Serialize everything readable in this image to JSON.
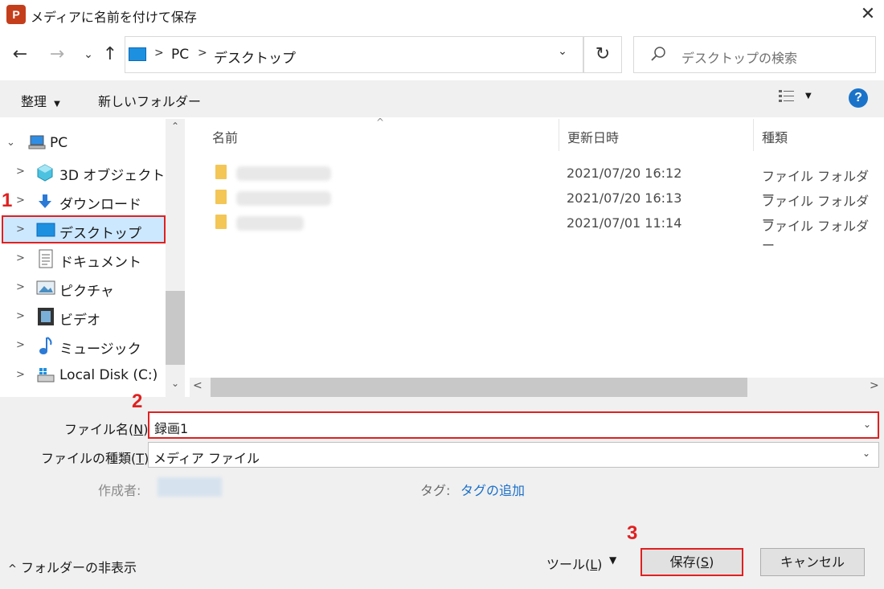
{
  "window": {
    "title": "メディアに名前を付けて保存",
    "app_icon_letter": "P"
  },
  "address": {
    "crumbs": [
      "PC",
      "デスクトップ"
    ]
  },
  "search": {
    "placeholder": "デスクトップの検索"
  },
  "toolbar": {
    "organize_label": "整理",
    "new_folder_label": "新しいフォルダー"
  },
  "nav_tree": {
    "root": "PC",
    "items": [
      {
        "label": "3D オブジェクト",
        "icon": "3d-objects-icon"
      },
      {
        "label": "ダウンロード",
        "icon": "download-icon"
      },
      {
        "label": "デスクトップ",
        "icon": "desktop-icon",
        "selected": true
      },
      {
        "label": "ドキュメント",
        "icon": "documents-icon"
      },
      {
        "label": "ピクチャ",
        "icon": "pictures-icon"
      },
      {
        "label": "ビデオ",
        "icon": "videos-icon"
      },
      {
        "label": "ミュージック",
        "icon": "music-icon"
      },
      {
        "label": "Local Disk (C:)",
        "icon": "local-disk-icon"
      }
    ]
  },
  "file_list": {
    "columns": [
      "名前",
      "更新日時",
      "種類"
    ],
    "rows": [
      {
        "date": "2021/07/20 16:12",
        "type": "ファイル フォルダー"
      },
      {
        "date": "2021/07/20 16:13",
        "type": "ファイル フォルダー"
      },
      {
        "date": "2021/07/01 11:14",
        "type": "ファイル フォルダー"
      }
    ]
  },
  "form": {
    "filename_label": "ファイル名(N):",
    "filename_label_prefix": "ファイル名(",
    "filename_label_key": "N",
    "filename_label_suffix": "):",
    "filename_value": "録画1",
    "filetype_label_prefix": "ファイルの種類(",
    "filetype_label_key": "T",
    "filetype_label_suffix": "):",
    "filetype_value": "メディア ファイル",
    "author_label": "作成者:",
    "tags_label": "タグ:",
    "tags_link": "タグの追加"
  },
  "footer": {
    "hide_folders_label": "フォルダーの非表示",
    "tools_prefix": "ツール(",
    "tools_key": "L",
    "tools_suffix": ")",
    "save_prefix": "保存(",
    "save_key": "S",
    "save_suffix": ")",
    "cancel_label": "キャンセル"
  },
  "markers": [
    "1",
    "2",
    "3"
  ],
  "colors": {
    "highlight_border": "#e02020",
    "selected_bg": "#cce8ff",
    "link": "#1a6fc9",
    "folder": "#f3c656"
  }
}
